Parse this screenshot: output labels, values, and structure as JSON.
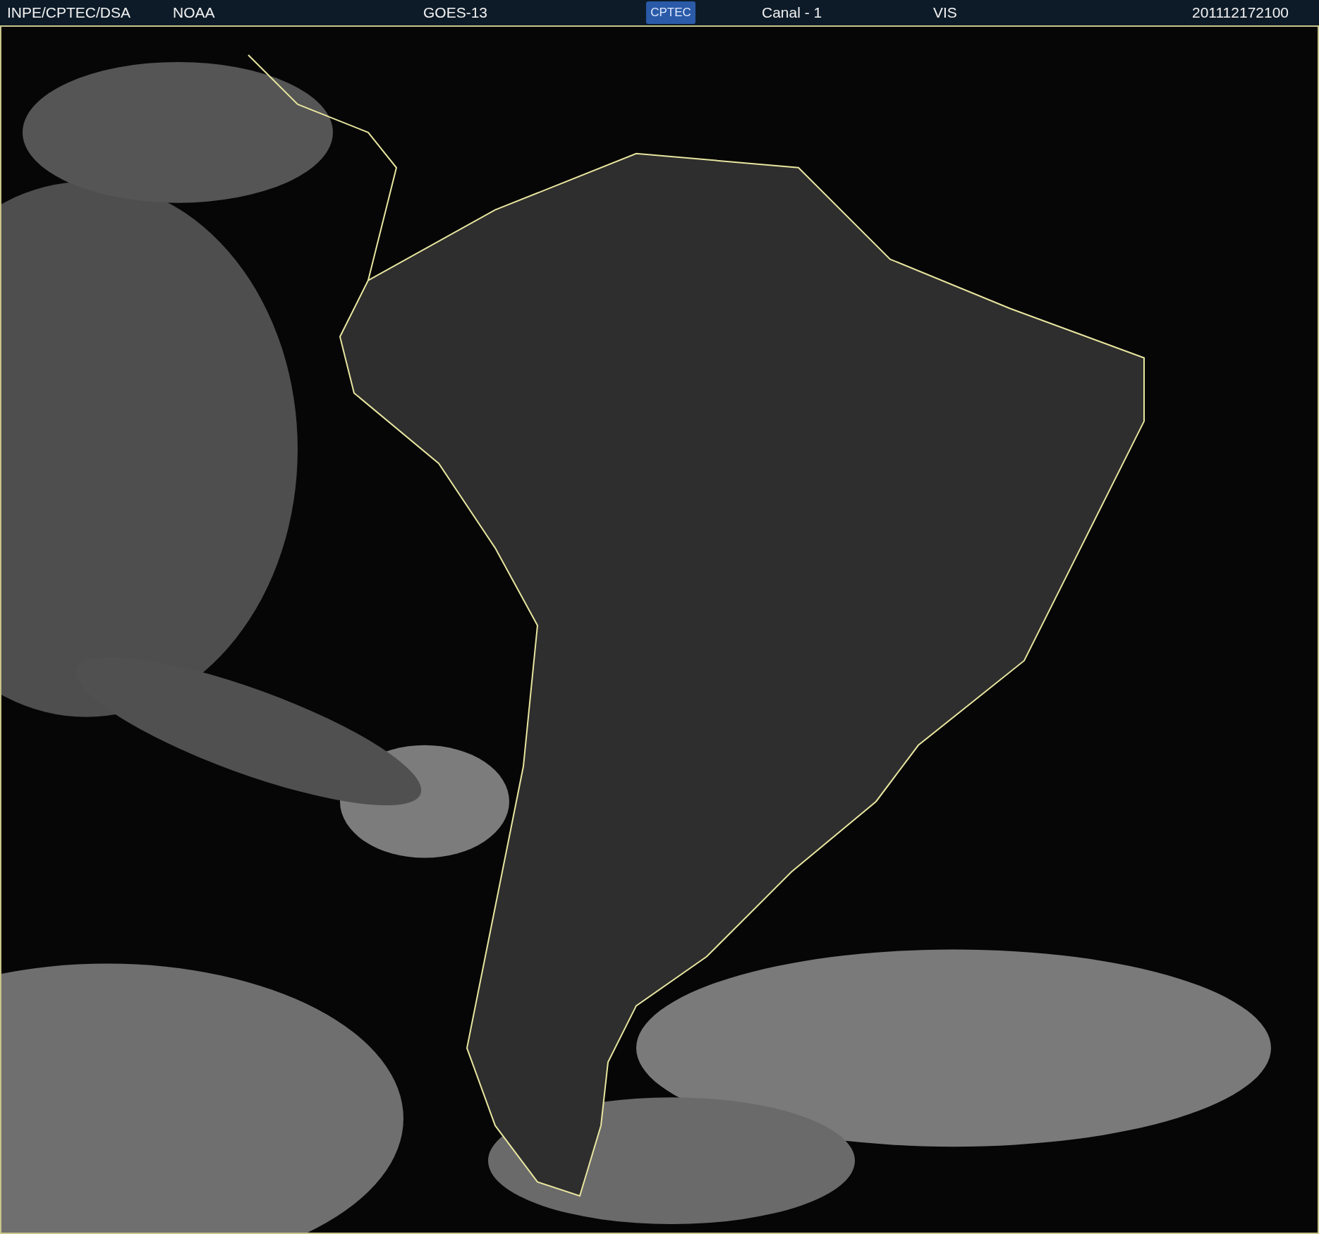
{
  "header": {
    "source": "INPE/CPTEC/DSA",
    "agency": "NOAA",
    "satellite": "GOES-13",
    "logo": "CPTEC",
    "channel": "Canal - 1",
    "band": "VIS",
    "timestamp": "201112172100"
  }
}
